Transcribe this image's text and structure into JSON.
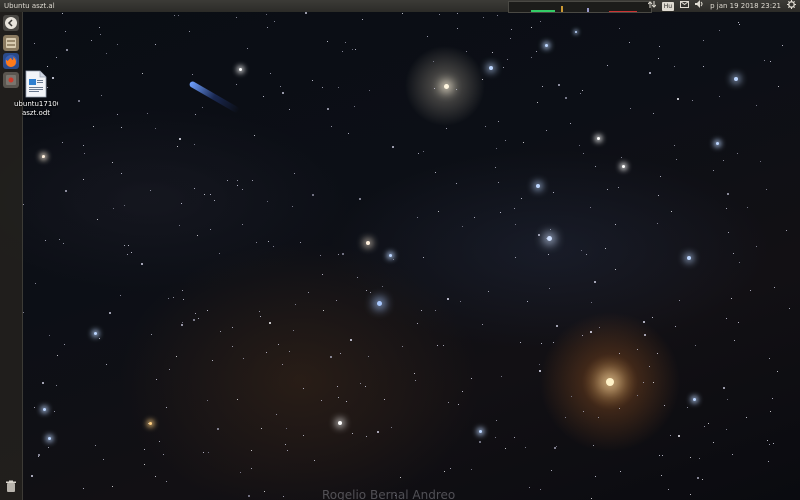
{
  "top_panel": {
    "window_title": "Ubuntu aszt.al",
    "keyboard_layout": "Hu",
    "clock": "p jan 19 2018   23:21",
    "indicator_icons": [
      "network-icon",
      "mail-icon",
      "volume-icon",
      "gear-icon"
    ]
  },
  "launcher": {
    "items": [
      {
        "name": "dash-home-button",
        "icon": "ubuntu-logo-icon"
      },
      {
        "name": "files-launcher",
        "icon": "files-icon"
      },
      {
        "name": "firefox-launcher",
        "icon": "firefox-icon"
      },
      {
        "name": "settings-launcher",
        "icon": "system-settings-icon"
      }
    ],
    "trash_icon": "trash-icon"
  },
  "desktop": {
    "icons": [
      {
        "label_line1": "ubuntu17100",
        "label_line2": "aszt.odt",
        "icon": "odt-document-icon"
      }
    ],
    "wallpaper_watermark": "Rogelio Bernal Andreo"
  },
  "colors": {
    "panel": "#2c2b28",
    "launcher": "#23211e",
    "accent_orange": "#ffaa50"
  }
}
